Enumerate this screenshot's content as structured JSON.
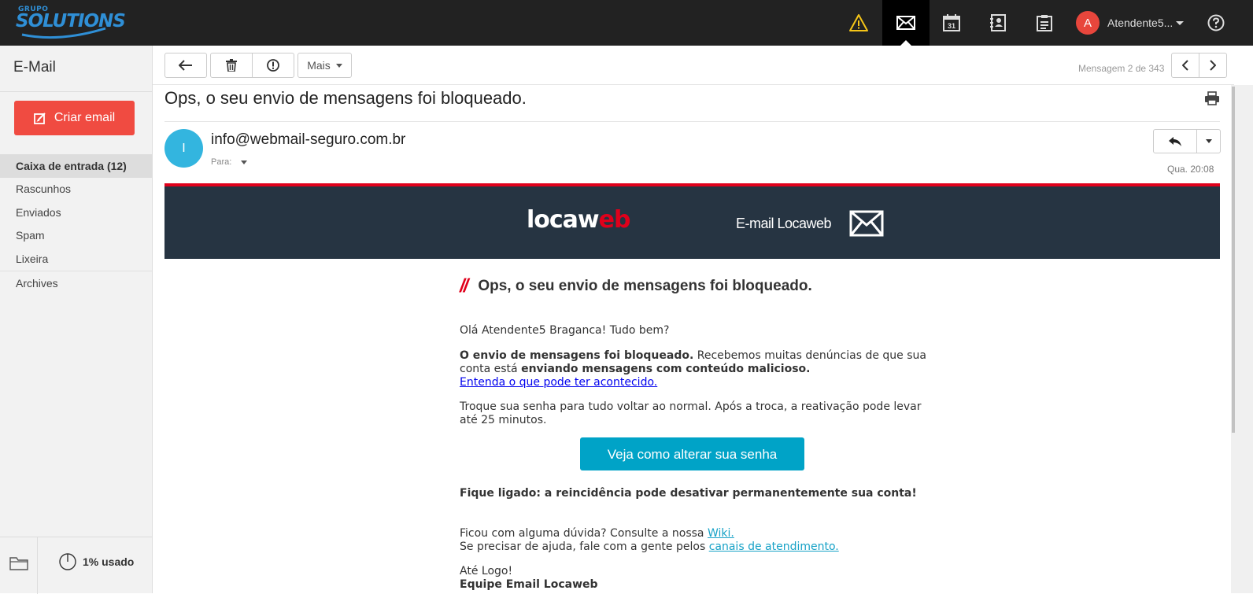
{
  "topbar": {
    "logo_small": "GRUPO",
    "logo_big": "SOLUTIONS",
    "icons": [
      "warning-icon",
      "mail-icon",
      "calendar-icon",
      "contacts-icon",
      "tasks-icon"
    ],
    "calendar_day": "31",
    "user_initial": "A",
    "user_name": "Atendente5...",
    "help_icon": "help-icon",
    "brand_color": "#2f8fd6"
  },
  "sidebar": {
    "title": "E-Mail",
    "create_label": "Criar email",
    "create_color": "#f04b41",
    "folders": [
      {
        "label": "Caixa de entrada  (12)",
        "active": true
      },
      {
        "label": "Rascunhos"
      },
      {
        "label": "Enviados"
      },
      {
        "label": "Spam"
      },
      {
        "label": "Lixeira"
      },
      {
        "label": "Archives"
      }
    ],
    "usage": "1% usado"
  },
  "toolbar": {
    "more_label": "Mais",
    "message_count": "Mensagem 2 de 343"
  },
  "message": {
    "subject": "Ops, o seu envio de mensagens foi bloqueado.",
    "sender_initial": "I",
    "sender": "info@webmail-seguro.com.br",
    "to_label": "Para:",
    "date": "Qua. 20:08"
  },
  "email_body": {
    "logo_part1": "locaw",
    "logo_part2": "eb",
    "banner_title": "E-mail Locaweb",
    "title_mark": "//",
    "title": "Ops, o seu envio de mensagens foi bloqueado.",
    "greeting": "Olá Atendente5 Braganca! Tudo bem?",
    "p1_bold1": "O envio de mensagens foi bloqueado.",
    "p1_text1": " Recebemos muitas denúncias de que sua conta está ",
    "p1_bold2": "enviando mensagens com conteúdo malicioso.",
    "p1_link": "Entenda o que pode ter acontecido.",
    "p2": "Troque sua senha para tudo voltar ao normal. Após a troca, a reativação pode levar até 25 minutos.",
    "cta": "Veja como alterar sua senha",
    "warning": "Fique ligado: a reincidência pode desativar permanentemente sua conta!",
    "help1_text": "Ficou com alguma dúvida? Consulte a nossa ",
    "help1_link": "Wiki.",
    "help2_text": "Se precisar de ajuda, fale com a gente pelos ",
    "help2_link": "canais de atendimento.",
    "closing": "Até Logo!",
    "signature": "Equipe Email Locaweb",
    "banner_color": "#263442",
    "accent_color": "#e0001b",
    "cta_color": "#00a3c7"
  }
}
